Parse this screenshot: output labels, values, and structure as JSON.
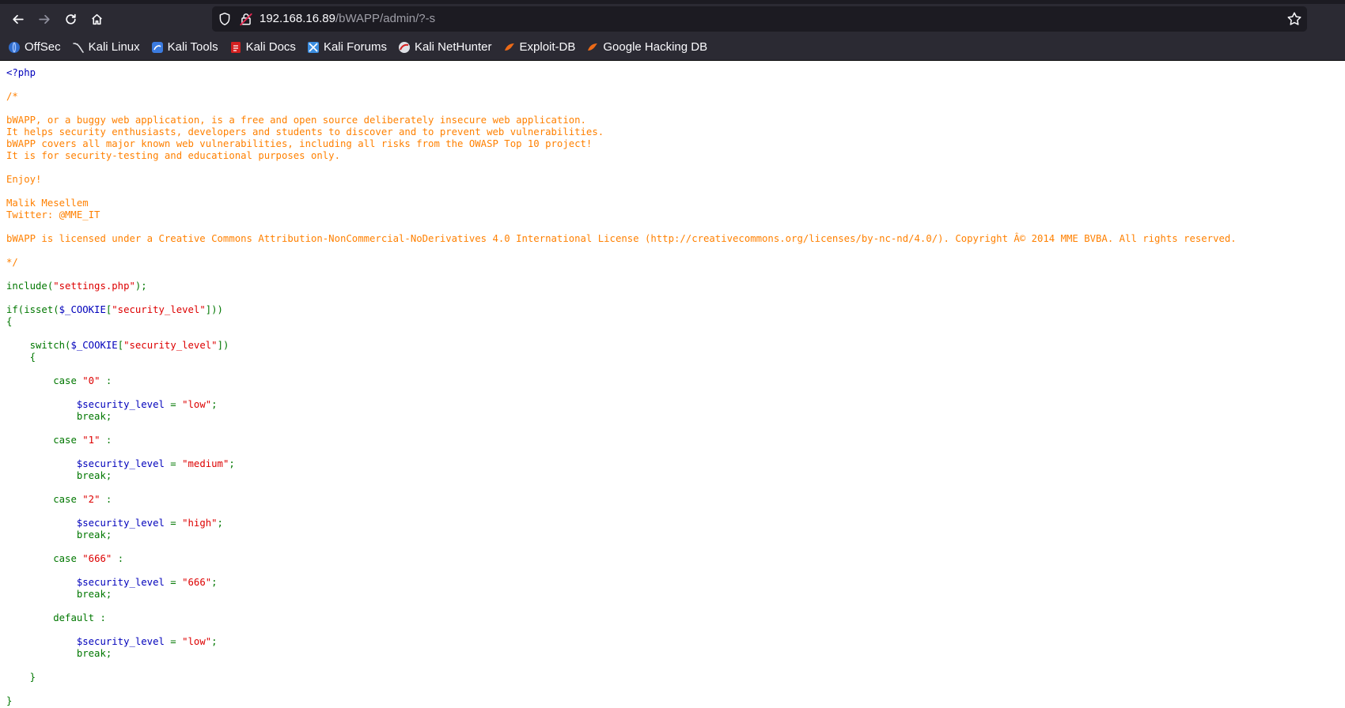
{
  "browser": {
    "url_host": "192.168.16.89",
    "url_path": "/bWAPP/admin/?-s"
  },
  "bookmarks": [
    {
      "label": "OffSec",
      "icon": "offsec-icon"
    },
    {
      "label": "Kali Linux",
      "icon": "kali-dragon-icon"
    },
    {
      "label": "Kali Tools",
      "icon": "kali-tools-icon"
    },
    {
      "label": "Kali Docs",
      "icon": "kali-docs-icon"
    },
    {
      "label": "Kali Forums",
      "icon": "kali-forums-icon"
    },
    {
      "label": "Kali NetHunter",
      "icon": "kali-nethunter-icon"
    },
    {
      "label": "Exploit-DB",
      "icon": "exploit-db-icon"
    },
    {
      "label": "Google Hacking DB",
      "icon": "google-hacking-db-icon"
    }
  ],
  "colors": {
    "php_tag": "#0000BB",
    "comment": "#FF8000",
    "keyword": "#007700",
    "string": "#DD0000"
  },
  "source": {
    "open_tag": "<?php",
    "comment_open": "/*",
    "comment_para1": [
      "bWAPP, or a buggy web application, is a free and open source deliberately insecure web application.",
      "It helps security enthusiasts, developers and students to discover and to prevent web vulnerabilities.",
      "bWAPP covers all major known web vulnerabilities, including all risks from the OWASP Top 10 project!",
      "It is for security-testing and educational purposes only."
    ],
    "comment_enjoy": "Enjoy!",
    "comment_author": "Malik Mesellem",
    "comment_twitter": "Twitter: @MME_IT",
    "comment_license": "bWAPP is licensed under a Creative Commons Attribution-NonCommercial-NoDerivatives 4.0 International License (http://creativecommons.org/licenses/by-nc-nd/4.0/). Copyright Â© 2014 MME BVBA. All rights reserved.",
    "comment_close": "*/",
    "include_call": "include(",
    "include_arg": "\"settings.php\"",
    "include_end": ");",
    "if_start": "if(isset(",
    "cookie_var": "$_COOKIE",
    "bracket_open": "[",
    "security_key": "\"security_level\"",
    "if_end": "]))",
    "brace_open": "{",
    "switch_start": "switch(",
    "switch_end": "])",
    "cases": [
      {
        "label": "\"0\"",
        "value": "\"low\""
      },
      {
        "label": "\"1\"",
        "value": "\"medium\""
      },
      {
        "label": "\"2\"",
        "value": "\"high\""
      },
      {
        "label": "\"666\"",
        "value": "\"666\""
      }
    ],
    "case_kw": "case ",
    "colon": " :",
    "assign_var": "$security_level",
    "assign_op": " = ",
    "semicolon": ";",
    "break_stmt": "break;",
    "default_kw": "default :",
    "default_value": "\"low\"",
    "brace_close": "}"
  }
}
